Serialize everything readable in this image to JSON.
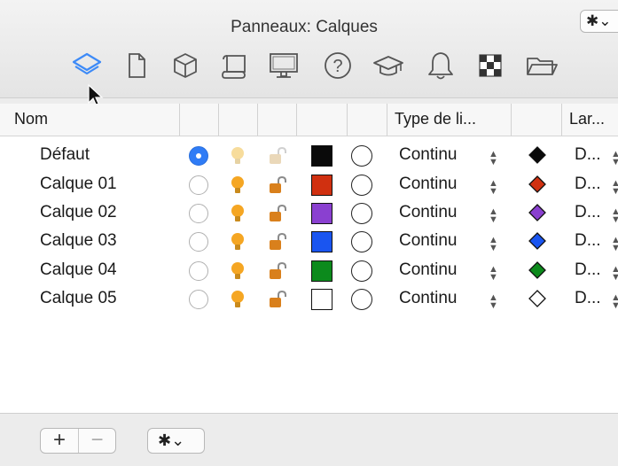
{
  "window": {
    "title": "Panneaux: Calques",
    "gear_glyph": "✱⌄"
  },
  "tabs": [
    {
      "name": "tab-layers",
      "icon": "layers-icon",
      "active": true
    },
    {
      "name": "tab-page",
      "icon": "page-icon"
    },
    {
      "name": "tab-3d",
      "icon": "cube-icon"
    },
    {
      "name": "tab-scroll",
      "icon": "scroll-icon"
    },
    {
      "name": "tab-display",
      "icon": "monitor-icon"
    },
    {
      "name": "tab-help",
      "icon": "help-icon"
    },
    {
      "name": "tab-learn",
      "icon": "graduation-cap-icon"
    },
    {
      "name": "tab-notifications",
      "icon": "bell-icon"
    },
    {
      "name": "tab-checker",
      "icon": "checkerboard-icon"
    },
    {
      "name": "tab-folder",
      "icon": "folder-icon"
    }
  ],
  "columns": {
    "name": "Nom",
    "line_type": "Type de li...",
    "width": "Lar..."
  },
  "layers": [
    {
      "name": "Défaut",
      "active": true,
      "visible": false,
      "locked": false,
      "color": "#0a0a0a",
      "line": "Continu",
      "width": "D..."
    },
    {
      "name": "Calque 01",
      "active": false,
      "visible": true,
      "locked": true,
      "color": "#d03010",
      "line": "Continu",
      "width": "D..."
    },
    {
      "name": "Calque 02",
      "active": false,
      "visible": true,
      "locked": true,
      "color": "#8a40d0",
      "line": "Continu",
      "width": "D..."
    },
    {
      "name": "Calque 03",
      "active": false,
      "visible": true,
      "locked": true,
      "color": "#1a55f0",
      "line": "Continu",
      "width": "D..."
    },
    {
      "name": "Calque 04",
      "active": false,
      "visible": true,
      "locked": true,
      "color": "#0c8a1c",
      "line": "Continu",
      "width": "D..."
    },
    {
      "name": "Calque 05",
      "active": false,
      "visible": true,
      "locked": true,
      "color": "#ffffff",
      "line": "Continu",
      "width": "D..."
    }
  ],
  "footer": {
    "add_label": "+",
    "remove_label": "−",
    "gear_glyph": "✱⌄"
  },
  "colors": {
    "accent": "#2f7cf6",
    "bulb_on": "#f5a623",
    "bulb_off": "#f7dc9c"
  }
}
